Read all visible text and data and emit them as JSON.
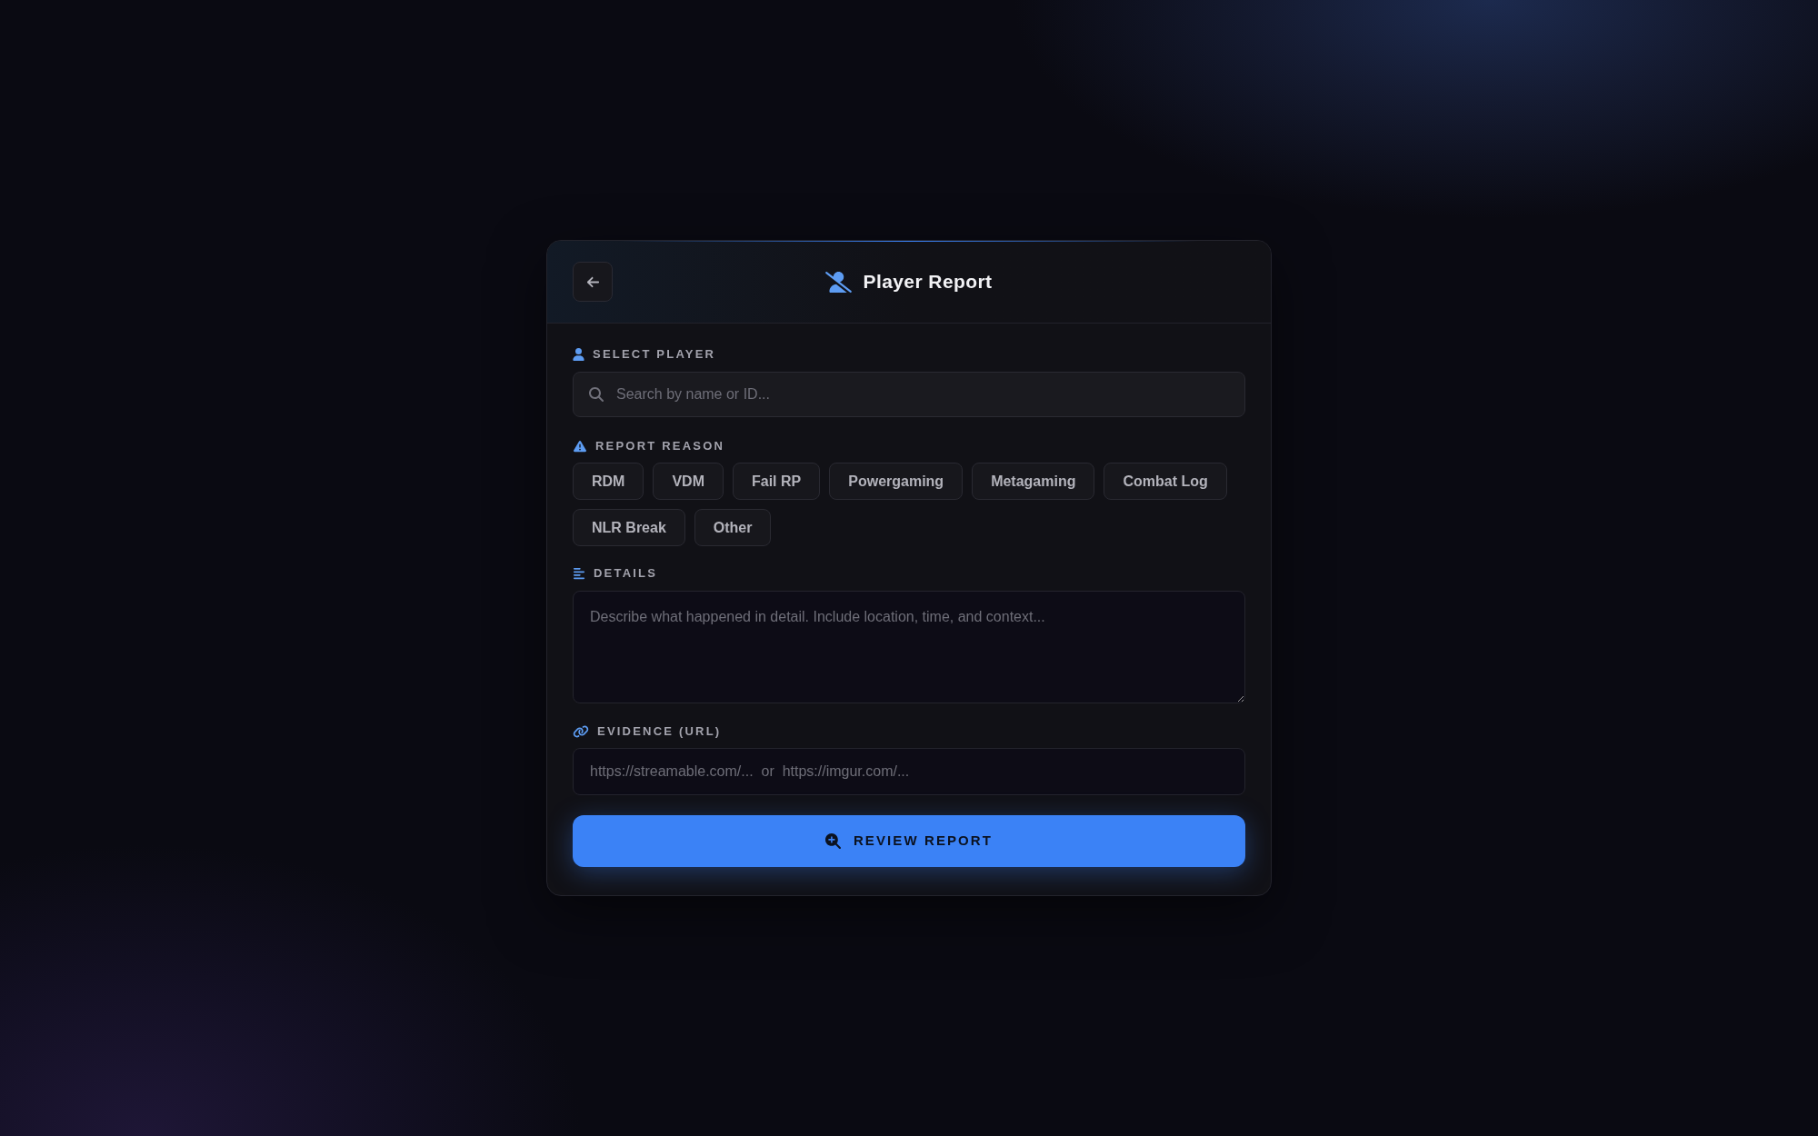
{
  "header": {
    "title": "Player Report"
  },
  "select_player": {
    "label": "SELECT PLAYER",
    "placeholder": "Search by name or ID..."
  },
  "report_reason": {
    "label": "REPORT REASON",
    "options": [
      {
        "label": "RDM",
        "selected": false
      },
      {
        "label": "VDM",
        "selected": false
      },
      {
        "label": "Fail RP",
        "selected": false
      },
      {
        "label": "Powergaming",
        "selected": false
      },
      {
        "label": "Metagaming",
        "selected": false
      },
      {
        "label": "Combat Log",
        "selected": false
      },
      {
        "label": "NLR Break",
        "selected": false
      },
      {
        "label": "Other",
        "selected": false
      }
    ]
  },
  "details": {
    "label": "DETAILS",
    "placeholder": "Describe what happened in detail. Include location, time, and context..."
  },
  "evidence": {
    "label": "EVIDENCE (URL)",
    "placeholder": "https://streamable.com/...  or  https://imgur.com/..."
  },
  "submit": {
    "label": "REVIEW REPORT"
  }
}
